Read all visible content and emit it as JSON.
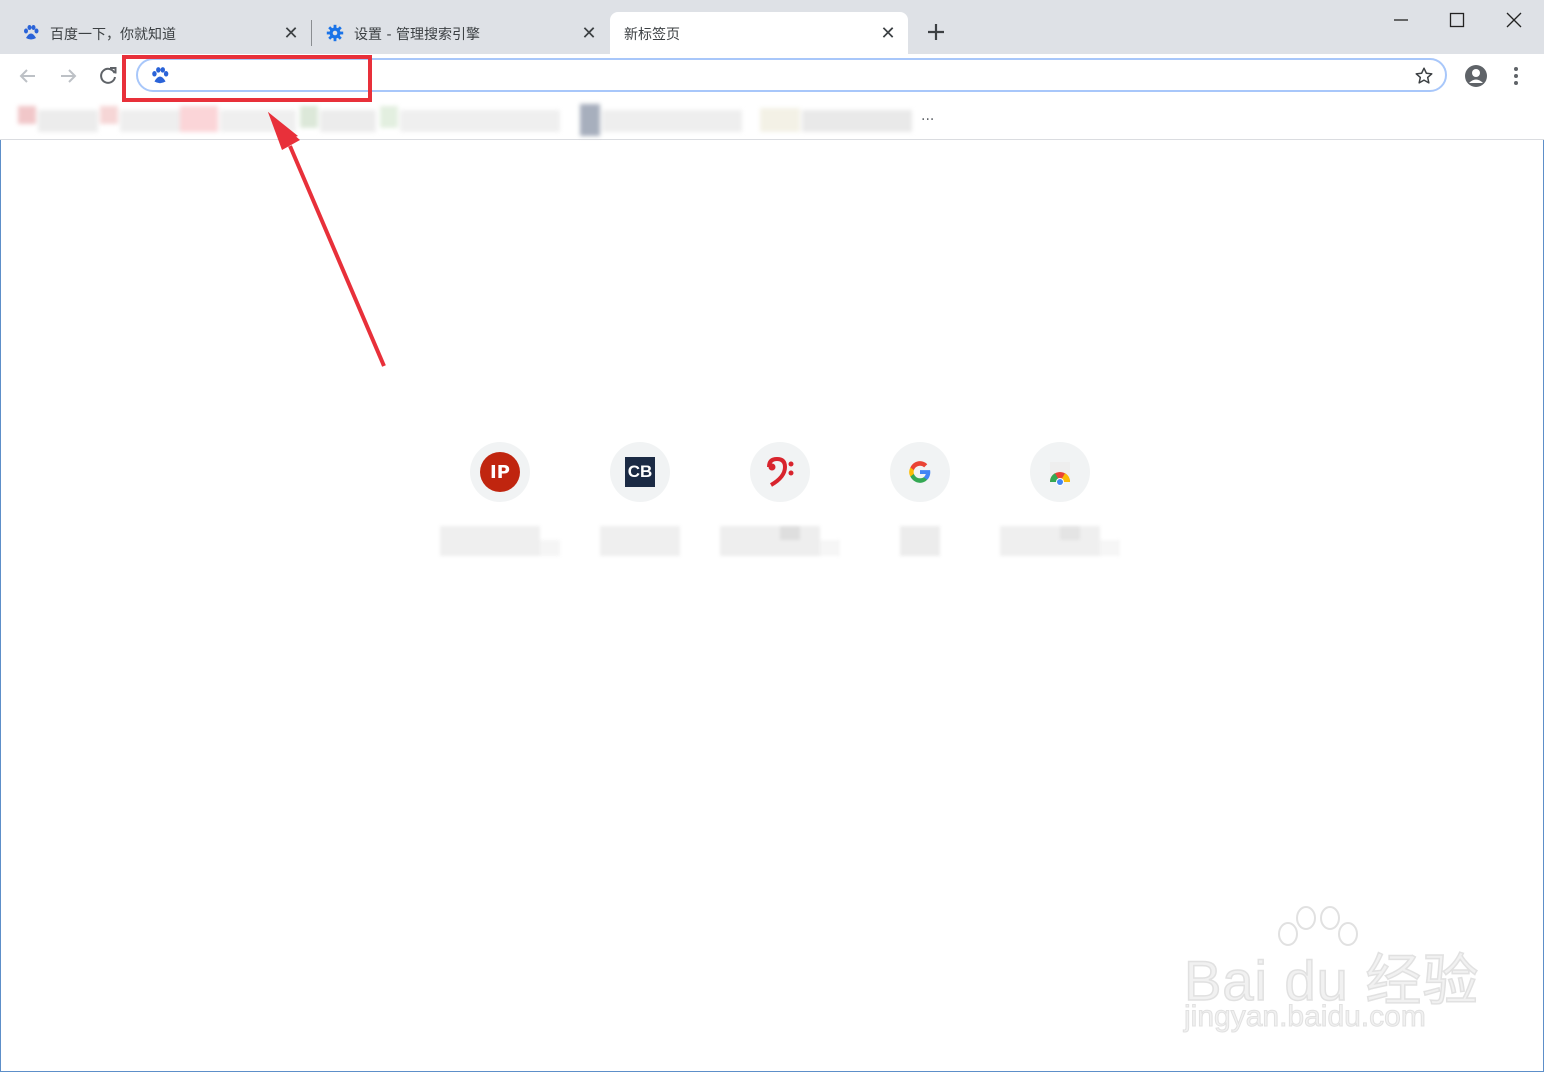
{
  "tabs": [
    {
      "title": "百度一下，你就知道",
      "favicon": "baidu-paw-icon",
      "active": false
    },
    {
      "title": "设置 - 管理搜索引擎",
      "favicon": "gear-icon",
      "active": false
    },
    {
      "title": "新标签页",
      "favicon": "",
      "active": true
    }
  ],
  "toolbar": {
    "omnibox_value": "",
    "search_engine_icon": "baidu-paw-icon"
  },
  "bookmarks": {
    "overflow_label": "..."
  },
  "shortcuts": [
    {
      "icon_text": "IP",
      "icon_color": "#c0250f",
      "label": ""
    },
    {
      "icon_text": "CB",
      "icon_color": "#1b2a44",
      "label": ""
    },
    {
      "icon_text": "",
      "icon_color": "#d8242d",
      "label": ""
    },
    {
      "icon_text": "G",
      "icon_color": "#4285f4",
      "label": ""
    },
    {
      "icon_text": "",
      "icon_color": "#ea4335",
      "label": ""
    }
  ],
  "watermark": {
    "brand": "Bai du 经验",
    "url": "jingyan.baidu.com"
  },
  "colors": {
    "tabstrip": "#dee1e6",
    "annotation_red": "#e8303a",
    "omnibox_focus": "#a8c7fa"
  }
}
